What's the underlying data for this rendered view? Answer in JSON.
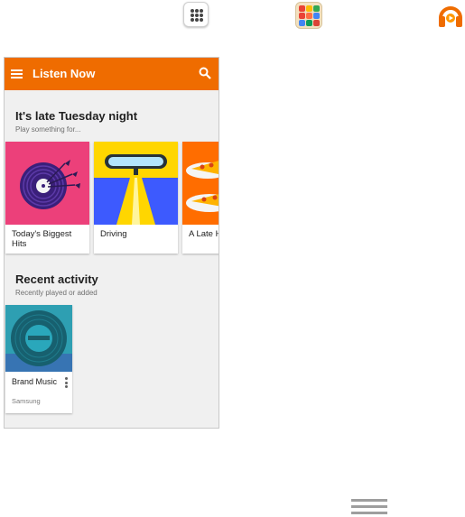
{
  "launcher": {
    "icons": [
      "apps-icon",
      "folder-icon",
      "play-music-icon"
    ]
  },
  "appbar": {
    "title": "Listen Now",
    "color": "#ef6c00"
  },
  "late_night": {
    "title": "It's late Tuesday night",
    "subtitle": "Play something for..."
  },
  "cards": [
    {
      "label": "Today's Biggest Hits"
    },
    {
      "label": "Driving"
    },
    {
      "label": "A Late Hang"
    }
  ],
  "recent": {
    "title": "Recent activity",
    "subtitle": "Recently played or added",
    "items": [
      {
        "title": "Brand Music",
        "subtitle": "Samsung"
      }
    ]
  },
  "colors": {
    "accent": "#ef6c00",
    "card_pink": "#ec407a",
    "card_yellow": "#ffd600",
    "card_orange": "#ff6d00",
    "album_teal": "#2e9fb2"
  }
}
